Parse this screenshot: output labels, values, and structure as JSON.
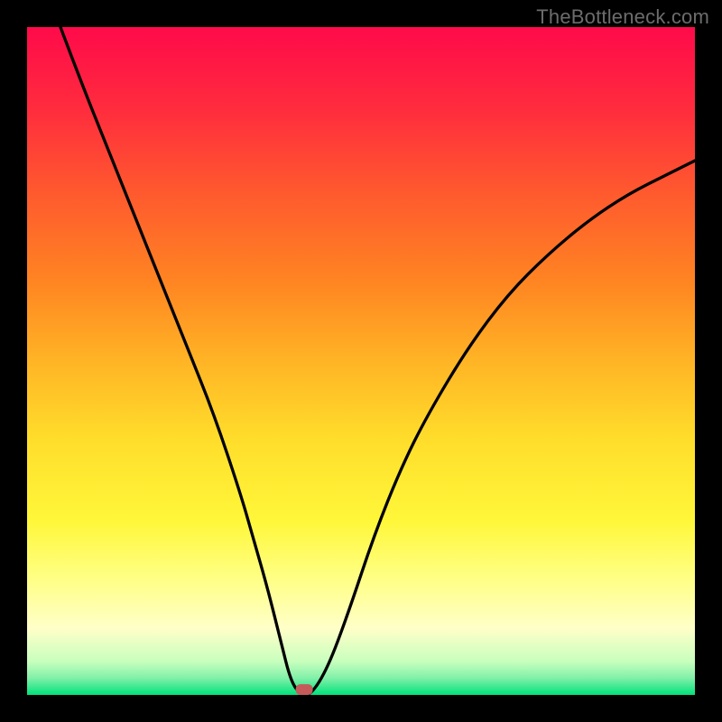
{
  "watermark": "TheBottleneck.com",
  "chart_data": {
    "type": "line",
    "title": "",
    "xlabel": "",
    "ylabel": "",
    "xlim": [
      0,
      100
    ],
    "ylim": [
      0,
      100
    ],
    "grid": false,
    "background": {
      "style": "vertical-gradient",
      "stops": [
        {
          "pos": 0.0,
          "color": "#ff0a4a"
        },
        {
          "pos": 0.12,
          "color": "#ff2b3e"
        },
        {
          "pos": 0.25,
          "color": "#ff5a2e"
        },
        {
          "pos": 0.38,
          "color": "#ff8422"
        },
        {
          "pos": 0.5,
          "color": "#ffb425"
        },
        {
          "pos": 0.62,
          "color": "#ffde2b"
        },
        {
          "pos": 0.74,
          "color": "#fff73a"
        },
        {
          "pos": 0.82,
          "color": "#ffff80"
        },
        {
          "pos": 0.9,
          "color": "#ffffc8"
        },
        {
          "pos": 0.95,
          "color": "#c8ffbe"
        },
        {
          "pos": 0.975,
          "color": "#80f0a8"
        },
        {
          "pos": 1.0,
          "color": "#00e27a"
        }
      ]
    },
    "series": [
      {
        "name": "bottleneck-curve",
        "color": "#000000",
        "x": [
          5,
          8,
          12,
          16,
          20,
          24,
          28,
          32,
          34,
          36,
          38,
          39.5,
          41,
          42.5,
          45,
          48,
          52,
          56,
          60,
          66,
          72,
          78,
          84,
          90,
          96,
          100
        ],
        "y": [
          100,
          92,
          82,
          72,
          62,
          52,
          42,
          30,
          23,
          16,
          8,
          2,
          0,
          0,
          4,
          12,
          24,
          34,
          42,
          52,
          60,
          66,
          71,
          75,
          78,
          80
        ]
      }
    ],
    "markers": [
      {
        "name": "valley-marker",
        "x": 41.5,
        "y": 0.8,
        "shape": "rounded-rect",
        "color": "#c55a5a",
        "size": 1.6
      }
    ]
  }
}
